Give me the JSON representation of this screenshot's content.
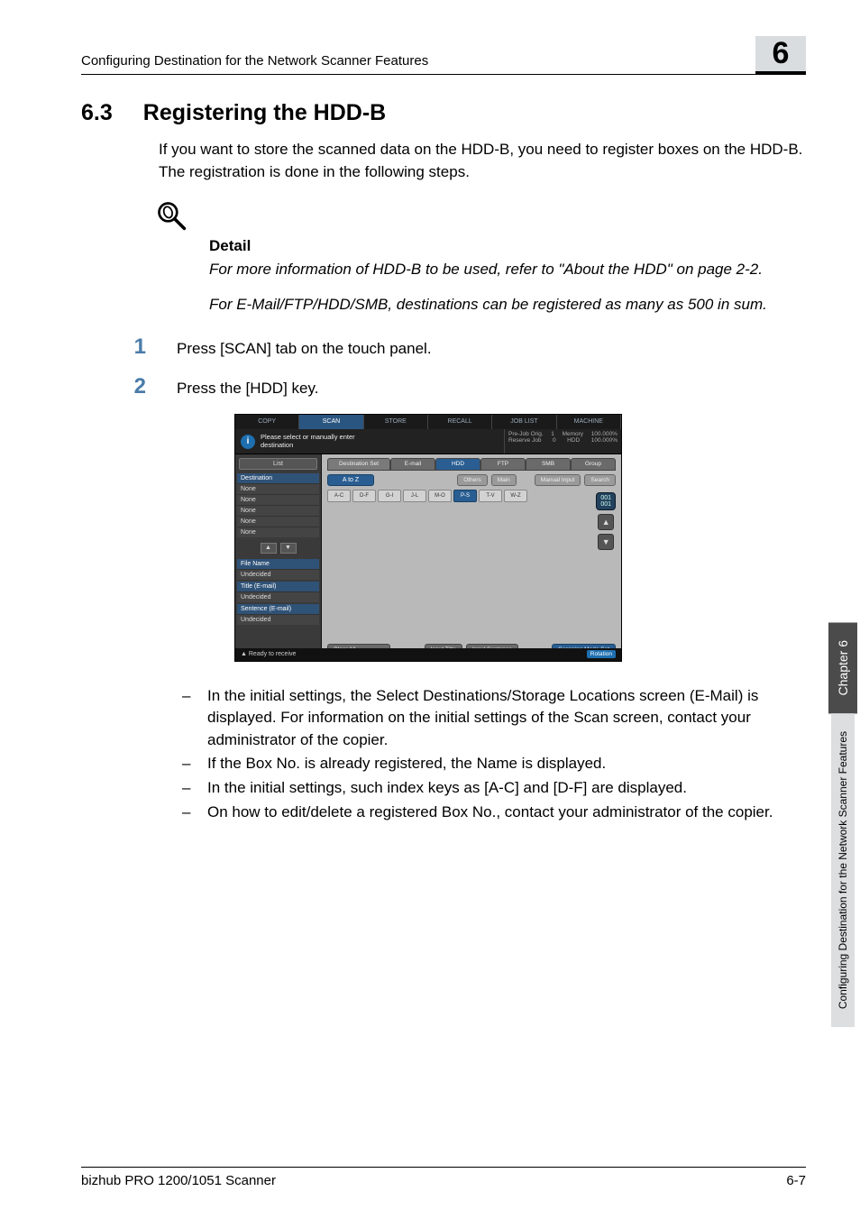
{
  "header": {
    "breadcrumb": "Configuring Destination for the Network Scanner Features",
    "chapter_number": "6"
  },
  "section": {
    "number": "6.3",
    "title": "Registering the HDD-B"
  },
  "intro": "If you want to store the scanned data on the HDD-B, you need to register boxes on the HDD-B. The registration is done in the following steps.",
  "detail": {
    "label": "Detail",
    "p1": "For more information of HDD-B to be used, refer to \"About the HDD\" on page 2-2.",
    "p2": "For E-Mail/FTP/HDD/SMB, destinations can be registered as many as 500 in sum."
  },
  "steps": [
    {
      "num": "1",
      "text": "Press  [SCAN] tab on the touch panel."
    },
    {
      "num": "2",
      "text": "Press the [HDD] key."
    }
  ],
  "screenshot": {
    "tabs": {
      "copy": "COPY",
      "scan": "SCAN",
      "store": "STORE",
      "recall": "RECALL",
      "joblist": "JOB LIST",
      "machine": "MACHINE"
    },
    "message": "Please select or manually enter\ndestination",
    "status_panel": {
      "row1": {
        "label": "Pre-Job Orig.",
        "count": "1",
        "mem_label": "Memory",
        "mem_val": "100.000%"
      },
      "row2": {
        "label": "Reserve Job",
        "count": "0",
        "hdd_label": "HDD",
        "hdd_val": "100.000%"
      }
    },
    "sidebar": {
      "list": "List",
      "destination_header": "Destination",
      "items": [
        "None",
        "None",
        "None",
        "None",
        "None"
      ],
      "file_name": {
        "label": "File Name",
        "value": "Undecided"
      },
      "title": {
        "label": "Title (E-mail)",
        "value": "Undecided"
      },
      "sentence": {
        "label": "Sentence (E-mail)",
        "value": "Undecided"
      }
    },
    "main": {
      "dest_set": "Destination Set",
      "email": "E-mail",
      "hdd": "HDD",
      "ftp": "FTP",
      "smb": "SMB",
      "group": "Group",
      "a_to_z": "A to Z",
      "others": "Others",
      "main": "Main",
      "manual_input": "Manual Input",
      "search": "Search",
      "index": [
        "A-C",
        "D-F",
        "G-I",
        "J-L",
        "M-O",
        "P-S",
        "T-V",
        "W-Z"
      ],
      "selected_index": "P-S",
      "counter": "001\n001",
      "clear_all": "Clear All",
      "input_title": "Input Title",
      "input_sentence": "Input Sentence",
      "scan_mode_set": "Scanning Mode Set"
    },
    "statusbar": {
      "ready": "Ready to receive",
      "rotation": "Rotation"
    }
  },
  "bullets": [
    "In the initial settings, the Select Destinations/Storage Locations screen (E-Mail) is displayed. For information on the initial settings of the Scan screen, contact your administrator of the copier.",
    "If the Box No. is already registered, the Name is displayed.",
    "In the initial settings, such index keys as [A-C] and [D-F] are displayed.",
    "On how to edit/delete a registered Box No., contact your administrator of the copier."
  ],
  "side_strip": {
    "chapter": "Chapter 6",
    "title": "Configuring Destination for the Network Scanner Features"
  },
  "footer": {
    "left": "bizhub PRO 1200/1051 Scanner",
    "right": "6-7"
  }
}
